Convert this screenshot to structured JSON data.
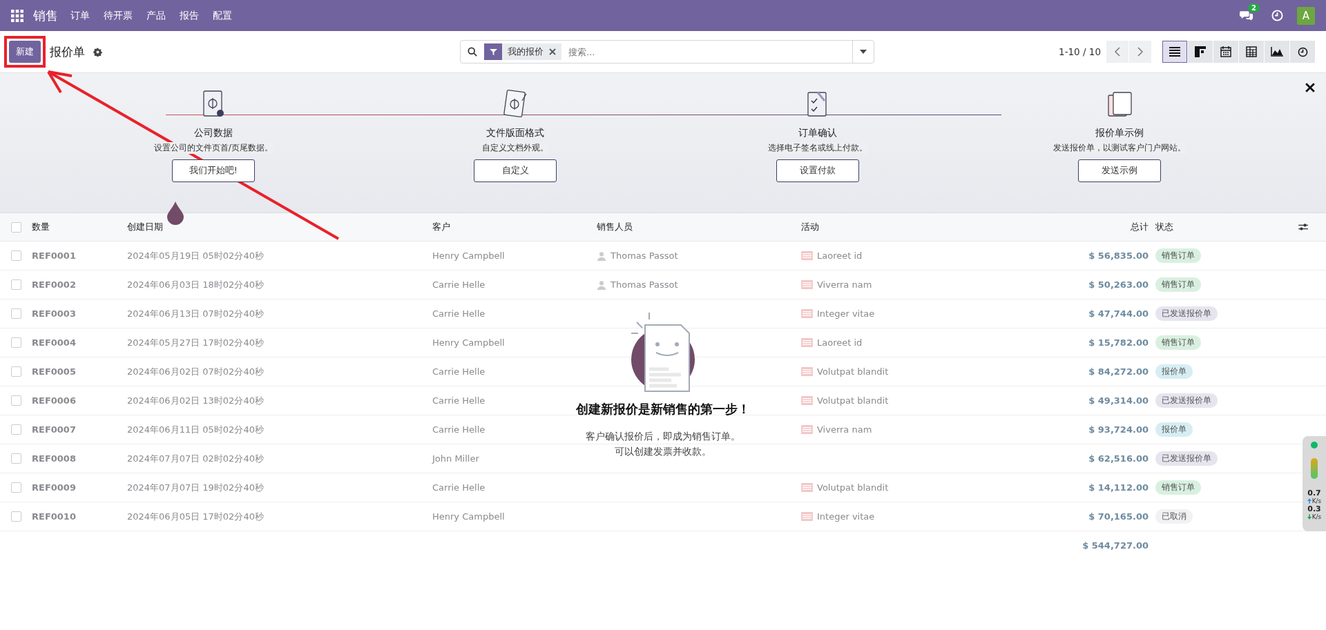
{
  "navbar": {
    "app_name": "销售",
    "menu": [
      "订单",
      "待开票",
      "产品",
      "报告",
      "配置"
    ],
    "messages_badge": "2",
    "avatar_letter": "A"
  },
  "control_panel": {
    "new_button": "新建",
    "title": "报价单",
    "search": {
      "facet": "我的报价",
      "placeholder": "搜索..."
    },
    "pager": "1-10 / 10",
    "views": [
      {
        "kind": "list",
        "selected": true
      },
      {
        "kind": "kanban",
        "selected": false
      },
      {
        "kind": "calendar",
        "selected": false
      },
      {
        "kind": "pivot",
        "selected": false
      },
      {
        "kind": "graph",
        "selected": false
      },
      {
        "kind": "activity",
        "selected": false
      }
    ]
  },
  "onboarding": {
    "steps": [
      {
        "kind": "company",
        "title": "公司数据",
        "description": "设置公司的文件页首/页尾数据。",
        "button": "我们开始吧!"
      },
      {
        "kind": "layout",
        "title": "文件版面格式",
        "description": "自定义文档外观。",
        "button": "自定义"
      },
      {
        "kind": "confirm",
        "title": "订单确认",
        "description": "选择电子签名或线上付款。",
        "button": "设置付款"
      },
      {
        "kind": "sample",
        "title": "报价单示例",
        "description": "发送报价单，以测试客户门户网站。",
        "button": "发送示例"
      }
    ]
  },
  "table": {
    "columns": [
      "数量",
      "创建日期",
      "客户",
      "销售人员",
      "活动",
      "总计",
      "状态"
    ],
    "rows": [
      {
        "checked": false,
        "number": "REF0001",
        "date": "2024年05月19日 05时02分40秒",
        "customer": "Henry Campbell",
        "salesperson": "Thomas Passot",
        "activity": "Laoreet id",
        "total": "$ 56,835.00",
        "status": "销售订单",
        "color": "#d9f0e1"
      },
      {
        "checked": false,
        "number": "REF0002",
        "date": "2024年06月03日 18时02分40秒",
        "customer": "Carrie Helle",
        "salesperson": "Thomas Passot",
        "activity": "Viverra nam",
        "total": "$ 50,263.00",
        "status": "销售订单",
        "color": "#d9f0e1"
      },
      {
        "checked": false,
        "number": "REF0003",
        "date": "2024年06月13日 07时02分40秒",
        "customer": "Carrie Helle",
        "activity": "Integer vitae",
        "total": "$ 47,744.00",
        "status": "已发送报价单",
        "color": "#e6e5ef"
      },
      {
        "checked": false,
        "number": "REF0004",
        "date": "2024年05月27日 17时02分40秒",
        "customer": "Henry Campbell",
        "activity": "Laoreet id",
        "total": "$ 15,782.00",
        "status": "销售订单",
        "color": "#d9f0e1"
      },
      {
        "checked": false,
        "number": "REF0005",
        "date": "2024年06月02日 07时02分40秒",
        "customer": "Carrie Helle",
        "activity": "Volutpat blandit",
        "total": "$ 84,272.00",
        "status": "报价单",
        "color": "#d6eef3"
      },
      {
        "checked": false,
        "number": "REF0006",
        "date": "2024年06月02日 13时02分40秒",
        "customer": "Carrie Helle",
        "activity": "Volutpat blandit",
        "total": "$ 49,314.00",
        "status": "已发送报价单",
        "color": "#e6e5ef"
      },
      {
        "checked": false,
        "number": "REF0007",
        "date": "2024年06月11日 05时02分40秒",
        "customer": "Carrie Helle",
        "activity": "Viverra nam",
        "total": "$ 93,724.00",
        "status": "报价单",
        "color": "#d6eef3"
      },
      {
        "checked": false,
        "number": "REF0008",
        "date": "2024年07月07日 02时02分40秒",
        "customer": "John Miller",
        "total": "$ 62,516.00",
        "status": "已发送报价单",
        "color": "#e6e5ef"
      },
      {
        "checked": false,
        "number": "REF0009",
        "date": "2024年07月07日 19时02分40秒",
        "customer": "Carrie Helle",
        "activity": "Volutpat blandit",
        "total": "$ 14,112.00",
        "status": "销售订单",
        "color": "#d9f0e1"
      },
      {
        "checked": false,
        "number": "REF0010",
        "date": "2024年06月05日 17时02分40秒",
        "customer": "Henry Campbell",
        "activity": "Integer vitae",
        "total": "$ 70,165.00",
        "status": "已取消",
        "color": "#f2f2f5"
      }
    ],
    "select_all_checked": false,
    "grand_total": "$ 544,727.00"
  },
  "empty_state": {
    "title": "创建新报价是新销售的第一步！",
    "lines": [
      "客户确认报价后，即成为销售订单。",
      "可以创建发票并收款。"
    ]
  },
  "speed_widget": {
    "upload": "0.7",
    "upload_unit": "K/s",
    "download": "0.3",
    "download_unit": "K/s"
  }
}
